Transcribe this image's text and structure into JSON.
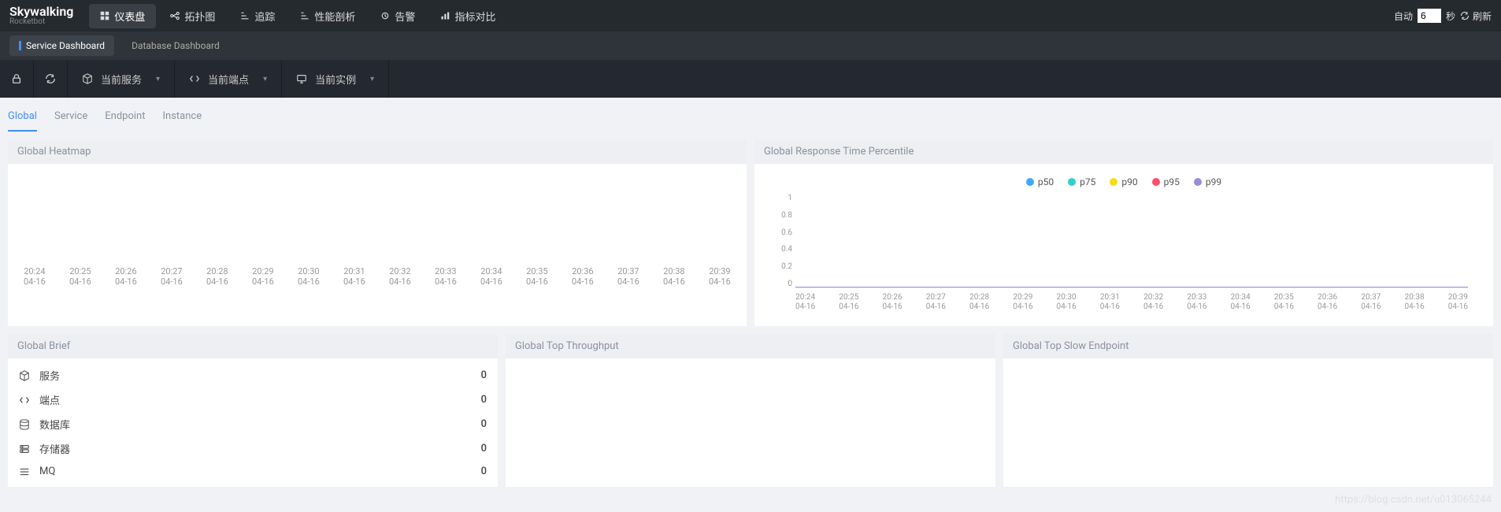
{
  "logo": {
    "top": "Skywalking",
    "bot": "Rocketbot"
  },
  "nav": [
    {
      "label": "仪表盘",
      "icon": "dashboard",
      "active": true
    },
    {
      "label": "拓扑图",
      "icon": "topology"
    },
    {
      "label": "追踪",
      "icon": "trace"
    },
    {
      "label": "性能剖析",
      "icon": "profile"
    },
    {
      "label": "告警",
      "icon": "alarm"
    },
    {
      "label": "指标对比",
      "icon": "compare"
    }
  ],
  "auto": {
    "label": "自动",
    "value": "6",
    "unit": "秒",
    "refresh": "刷新"
  },
  "dash_tabs": [
    {
      "label": "Service Dashboard",
      "active": true
    },
    {
      "label": "Database Dashboard"
    }
  ],
  "selectors": {
    "lock": "lock",
    "reload": "reload",
    "service": "当前服务",
    "endpoint": "当前端点",
    "instance": "当前实例"
  },
  "scope_tabs": [
    {
      "label": "Global",
      "active": true
    },
    {
      "label": "Service"
    },
    {
      "label": "Endpoint"
    },
    {
      "label": "Instance"
    }
  ],
  "heatmap": {
    "title": "Global Heatmap",
    "ticks": [
      "20:24",
      "20:25",
      "20:26",
      "20:27",
      "20:28",
      "20:29",
      "20:30",
      "20:31",
      "20:32",
      "20:33",
      "20:34",
      "20:35",
      "20:36",
      "20:37",
      "20:38",
      "20:39"
    ],
    "date": "04-16"
  },
  "percentile": {
    "title": "Global Response Time Percentile",
    "legend": [
      {
        "name": "p50",
        "color": "#3fa7ff"
      },
      {
        "name": "p75",
        "color": "#36cfc9"
      },
      {
        "name": "p90",
        "color": "#fadb14"
      },
      {
        "name": "p95",
        "color": "#ff4d6a"
      },
      {
        "name": "p99",
        "color": "#9b8cd8"
      }
    ],
    "yticks": [
      "1",
      "0.8",
      "0.6",
      "0.4",
      "0.2",
      "0"
    ],
    "xticks": [
      "20:24",
      "20:25",
      "20:26",
      "20:27",
      "20:28",
      "20:29",
      "20:30",
      "20:31",
      "20:32",
      "20:33",
      "20:34",
      "20:35",
      "20:36",
      "20:37",
      "20:38",
      "20:39"
    ],
    "date": "04-16"
  },
  "brief": {
    "title": "Global Brief",
    "rows": [
      {
        "label": "服务",
        "value": "0",
        "icon": "cube"
      },
      {
        "label": "端点",
        "value": "0",
        "icon": "code"
      },
      {
        "label": "数据库",
        "value": "0",
        "icon": "db"
      },
      {
        "label": "存储器",
        "value": "0",
        "icon": "storage"
      },
      {
        "label": "MQ",
        "value": "0",
        "icon": "mq"
      }
    ]
  },
  "top_throughput": {
    "title": "Global Top Throughput"
  },
  "top_slow": {
    "title": "Global Top Slow Endpoint"
  },
  "chart_data": [
    {
      "type": "heatmap",
      "title": "Global Heatmap",
      "x": [
        "20:24",
        "20:25",
        "20:26",
        "20:27",
        "20:28",
        "20:29",
        "20:30",
        "20:31",
        "20:32",
        "20:33",
        "20:34",
        "20:35",
        "20:36",
        "20:37",
        "20:38",
        "20:39"
      ],
      "x_date": "04-16",
      "values": []
    },
    {
      "type": "line",
      "title": "Global Response Time Percentile",
      "x": [
        "20:24",
        "20:25",
        "20:26",
        "20:27",
        "20:28",
        "20:29",
        "20:30",
        "20:31",
        "20:32",
        "20:33",
        "20:34",
        "20:35",
        "20:36",
        "20:37",
        "20:38",
        "20:39"
      ],
      "x_date": "04-16",
      "ylim": [
        0,
        1
      ],
      "series": [
        {
          "name": "p50",
          "values": [
            0,
            0,
            0,
            0,
            0,
            0,
            0,
            0,
            0,
            0,
            0,
            0,
            0,
            0,
            0,
            0
          ]
        },
        {
          "name": "p75",
          "values": [
            0,
            0,
            0,
            0,
            0,
            0,
            0,
            0,
            0,
            0,
            0,
            0,
            0,
            0,
            0,
            0
          ]
        },
        {
          "name": "p90",
          "values": [
            0,
            0,
            0,
            0,
            0,
            0,
            0,
            0,
            0,
            0,
            0,
            0,
            0,
            0,
            0,
            0
          ]
        },
        {
          "name": "p95",
          "values": [
            0,
            0,
            0,
            0,
            0,
            0,
            0,
            0,
            0,
            0,
            0,
            0,
            0,
            0,
            0,
            0
          ]
        },
        {
          "name": "p99",
          "values": [
            0,
            0,
            0,
            0,
            0,
            0,
            0,
            0,
            0,
            0,
            0,
            0,
            0,
            0,
            0,
            0
          ]
        }
      ]
    }
  ],
  "watermark": "https://blog.csdn.net/u013065244"
}
